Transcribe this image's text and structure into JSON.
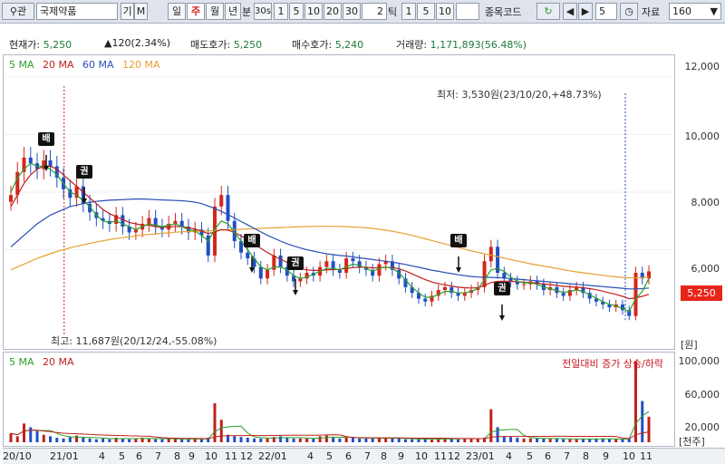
{
  "toolbar": {
    "search_icon": "magnifier-icon",
    "search_btn": "관",
    "stock_name": "국제약품",
    "btn_gi": "기",
    "btn_m": "M",
    "period_tabs": [
      "일",
      "주",
      "월",
      "년"
    ],
    "active_period": "주",
    "min_label": "분",
    "min_value": "30s",
    "min_options": [
      "1",
      "5",
      "10",
      "20",
      "30"
    ],
    "tick_value": "2",
    "tick_label": "틱",
    "tick_options": [
      "1",
      "5",
      "10"
    ],
    "code_label": "종목코드",
    "refresh_icon": "refresh-icon",
    "prev_icon": "arrow-left-icon",
    "next_icon": "arrow-right-icon",
    "step_value": "5",
    "clock_icon": "clock-icon",
    "data_label": "자료",
    "data_count": "160"
  },
  "quote": {
    "price_label": "현재가:",
    "price": "5,250",
    "change": "▲120(2.34%)",
    "ask_label": "매도호가:",
    "ask": "5,250",
    "bid_label": "매수호가:",
    "bid": "5,240",
    "volume_label": "거래량:",
    "volume": "1,171,893(56.48%)"
  },
  "legend_price": [
    {
      "name": "5 MA",
      "color": "#2aa02a"
    },
    {
      "name": "20 MA",
      "color": "#c0201a"
    },
    {
      "name": "60 MA",
      "color": "#2a4fb5"
    },
    {
      "name": "120 MA",
      "color": "#e8a030"
    }
  ],
  "legend_volume": [
    {
      "name": "5 MA",
      "color": "#2aa02a"
    },
    {
      "name": "20 MA",
      "color": "#c0201a"
    }
  ],
  "annotations": {
    "low": "최저: 3,530원(23/10/20,+48.73%)",
    "high": "최고: 11,687원(20/12/24,-55.08%)",
    "volume_note": "전일대비 증가 상승/하락"
  },
  "markers": [
    {
      "label": "배"
    },
    {
      "label": "권"
    },
    {
      "label": "배"
    },
    {
      "label": "권"
    },
    {
      "label": "배"
    },
    {
      "label": "권"
    }
  ],
  "price_axis": {
    "ticks": [
      "12,000",
      "10,000",
      "8,000",
      "6,000"
    ],
    "unit": "[원]",
    "current": "5,250"
  },
  "volume_axis": {
    "ticks": [
      "100,000",
      "60,000",
      "20,000"
    ],
    "unit": "[천주]"
  },
  "x_axis": [
    "20/10",
    "21/01",
    "4",
    "5",
    "6",
    "7",
    "8",
    "9",
    "10",
    "11",
    "12",
    "22/01",
    "4",
    "5",
    "6",
    "7",
    "8",
    "9",
    "10",
    "11",
    "12",
    "23/01",
    "4",
    "5",
    "6",
    "7",
    "8",
    "9",
    "10",
    "11"
  ],
  "chart_data": {
    "type": "candlestick",
    "title": "국제약품",
    "period": "weekly",
    "y_range": [
      3500,
      12500
    ],
    "ylabel": "원",
    "volume_ylabel": "천주",
    "current_price": 5250,
    "high": {
      "value": 11687,
      "date": "20/12/24"
    },
    "low": {
      "value": 3530,
      "date": "23/10/20"
    },
    "close_series": [
      7900,
      8700,
      9200,
      9000,
      8800,
      9100,
      8900,
      8500,
      8100,
      7800,
      8200,
      7600,
      7300,
      7100,
      7000,
      6900,
      7200,
      6800,
      6600,
      6700,
      6900,
      7100,
      6800,
      6700,
      6900,
      7000,
      6800,
      6600,
      6700,
      6500,
      5800,
      7500,
      7900,
      7000,
      6300,
      5900,
      5700,
      5400,
      5000,
      5300,
      5800,
      5400,
      5100,
      4900,
      5000,
      5200,
      5100,
      5400,
      5600,
      5300,
      5200,
      5700,
      5600,
      5400,
      5300,
      5100,
      5500,
      5600,
      5300,
      5000,
      4700,
      4500,
      4300,
      4200,
      4400,
      4600,
      4700,
      4500,
      4400,
      4500,
      4600,
      4700,
      5600,
      6100,
      5200,
      5000,
      4900,
      4800,
      4800,
      4900,
      4800,
      4600,
      4700,
      4500,
      4400,
      4600,
      4700,
      4500,
      4300,
      4200,
      4100,
      4000,
      4100,
      3900,
      3700,
      5200,
      5000,
      5250
    ],
    "ma_5": [
      8000,
      8500,
      8800,
      9000,
      8900,
      8900,
      8800,
      8600,
      8300,
      8000,
      7900,
      7700,
      7500,
      7200,
      7000,
      6950,
      7000,
      6900,
      6800,
      6700,
      6800,
      6900,
      6850,
      6800,
      6850,
      6900,
      6800,
      6700,
      6650,
      6500,
      6300,
      6700,
      7000,
      6900,
      6600,
      6300,
      6000,
      5700,
      5400,
      5300,
      5400,
      5400,
      5300,
      5100,
      5000,
      5050,
      5150,
      5250,
      5350,
      5350,
      5300,
      5400,
      5500,
      5450,
      5350,
      5250,
      5350,
      5400,
      5350,
      5200,
      4950,
      4700,
      4500,
      4350,
      4350,
      4450,
      4550,
      4550,
      4500,
      4500,
      4550,
      4650,
      4950,
      5300,
      5350,
      5250,
      5050,
      4900,
      4850,
      4850,
      4800,
      4700,
      4650,
      4580,
      4520,
      4550,
      4600,
      4550,
      4430,
      4320,
      4200,
      4100,
      4050,
      3960,
      3850,
      4300,
      4550,
      5000
    ],
    "ma_20": [
      7500,
      7900,
      8300,
      8600,
      8800,
      8900,
      8900,
      8800,
      8600,
      8400,
      8200,
      8000,
      7800,
      7600,
      7400,
      7250,
      7150,
      7050,
      6950,
      6900,
      6850,
      6850,
      6800,
      6780,
      6790,
      6810,
      6800,
      6760,
      6720,
      6650,
      6560,
      6620,
      6700,
      6680,
      6600,
      6480,
      6350,
      6200,
      6050,
      5900,
      5780,
      5670,
      5560,
      5450,
      5360,
      5300,
      5280,
      5280,
      5300,
      5310,
      5320,
      5350,
      5380,
      5390,
      5390,
      5370,
      5380,
      5390,
      5380,
      5340,
      5260,
      5160,
      5060,
      4960,
      4880,
      4820,
      4780,
      4740,
      4700,
      4680,
      4670,
      4680,
      4760,
      4860,
      4900,
      4910,
      4900,
      4890,
      4870,
      4860,
      4840,
      4810,
      4790,
      4760,
      4730,
      4710,
      4700,
      4680,
      4650,
      4610,
      4560,
      4500,
      4450,
      4380,
      4300,
      4330,
      4380,
      4450
    ],
    "ma_60": [
      6100,
      6300,
      6500,
      6700,
      6900,
      7050,
      7200,
      7300,
      7400,
      7500,
      7550,
      7600,
      7650,
      7680,
      7700,
      7720,
      7730,
      7740,
      7750,
      7760,
      7760,
      7750,
      7740,
      7730,
      7720,
      7710,
      7700,
      7680,
      7650,
      7600,
      7520,
      7430,
      7330,
      7220,
      7100,
      6980,
      6860,
      6740,
      6620,
      6500,
      6400,
      6300,
      6210,
      6130,
      6060,
      6000,
      5950,
      5900,
      5860,
      5830,
      5800,
      5780,
      5750,
      5720,
      5690,
      5660,
      5630,
      5600,
      5570,
      5530,
      5490,
      5440,
      5390,
      5340,
      5290,
      5250,
      5210,
      5170,
      5130,
      5100,
      5070,
      5050,
      5040,
      5040,
      5030,
      5020,
      5000,
      4980,
      4960,
      4940,
      4920,
      4900,
      4880,
      4860,
      4840,
      4820,
      4800,
      4780,
      4760,
      4740,
      4720,
      4700,
      4680,
      4660,
      4640,
      4640,
      4650,
      4670
    ],
    "ma_120": [
      5300,
      5400,
      5500,
      5600,
      5700,
      5780,
      5860,
      5940,
      6000,
      6060,
      6120,
      6170,
      6220,
      6270,
      6310,
      6350,
      6390,
      6420,
      6450,
      6480,
      6510,
      6530,
      6550,
      6570,
      6590,
      6610,
      6620,
      6630,
      6640,
      6650,
      6660,
      6670,
      6680,
      6690,
      6700,
      6710,
      6720,
      6730,
      6740,
      6750,
      6760,
      6770,
      6780,
      6790,
      6800,
      6805,
      6810,
      6815,
      6815,
      6815,
      6810,
      6800,
      6790,
      6780,
      6760,
      6740,
      6710,
      6680,
      6640,
      6600,
      6550,
      6500,
      6440,
      6380,
      6320,
      6260,
      6200,
      6140,
      6080,
      6020,
      5960,
      5910,
      5860,
      5810,
      5760,
      5710,
      5660,
      5610,
      5560,
      5510,
      5470,
      5430,
      5390,
      5350,
      5310,
      5270,
      5230,
      5200,
      5170,
      5140,
      5110,
      5080,
      5060,
      5040,
      5020,
      5020,
      5030,
      5050
    ],
    "volume_series": [
      12,
      8,
      25,
      20,
      15,
      10,
      8,
      6,
      5,
      7,
      9,
      6,
      5,
      4,
      5,
      4,
      6,
      5,
      4,
      5,
      6,
      5,
      4,
      4,
      5,
      5,
      4,
      4,
      5,
      4,
      6,
      52,
      30,
      10,
      8,
      7,
      6,
      5,
      5,
      5,
      7,
      8,
      6,
      5,
      5,
      5,
      5,
      8,
      9,
      6,
      5,
      7,
      6,
      5,
      5,
      5,
      6,
      6,
      5,
      5,
      4,
      4,
      4,
      4,
      4,
      5,
      5,
      5,
      4,
      5,
      5,
      5,
      6,
      44,
      20,
      8,
      7,
      6,
      5,
      5,
      5,
      5,
      5,
      5,
      4,
      4,
      4,
      5,
      4,
      5,
      5,
      4,
      4,
      4,
      5,
      108,
      55,
      34
    ],
    "volume_range": [
      0,
      110
    ],
    "volume_unit": "천주 (thousand shares, scaled /1000)"
  }
}
